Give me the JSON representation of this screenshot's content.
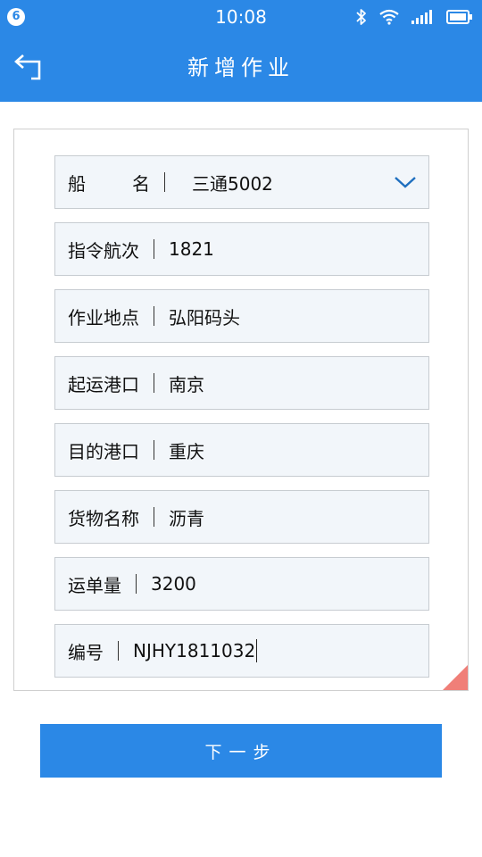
{
  "status_bar": {
    "notification_count": "6",
    "time": "10:08",
    "icons": [
      "bluetooth-icon",
      "wifi-icon",
      "signal-icon",
      "battery-icon"
    ]
  },
  "header": {
    "title": "新增作业",
    "back_icon": "back-arrow-icon"
  },
  "form": {
    "fields": [
      {
        "label": "船名",
        "value": "三通5002",
        "type": "select"
      },
      {
        "label": "指令航次",
        "value": "1821",
        "type": "text"
      },
      {
        "label": "作业地点",
        "value": "弘阳码头",
        "type": "text"
      },
      {
        "label": "起运港口",
        "value": "南京",
        "type": "text"
      },
      {
        "label": "目的港口",
        "value": "重庆",
        "type": "text"
      },
      {
        "label": "货物名称",
        "value": "沥青",
        "type": "text"
      },
      {
        "label": "运单量",
        "value": "3200",
        "type": "text"
      },
      {
        "label": "编号",
        "value": "NJHY1811032",
        "type": "text",
        "focused": true
      }
    ]
  },
  "actions": {
    "next_label": "下一步"
  },
  "colors": {
    "primary": "#2b88e6",
    "field_bg": "#f2f6fa",
    "corner_accent": "#f07f78"
  }
}
